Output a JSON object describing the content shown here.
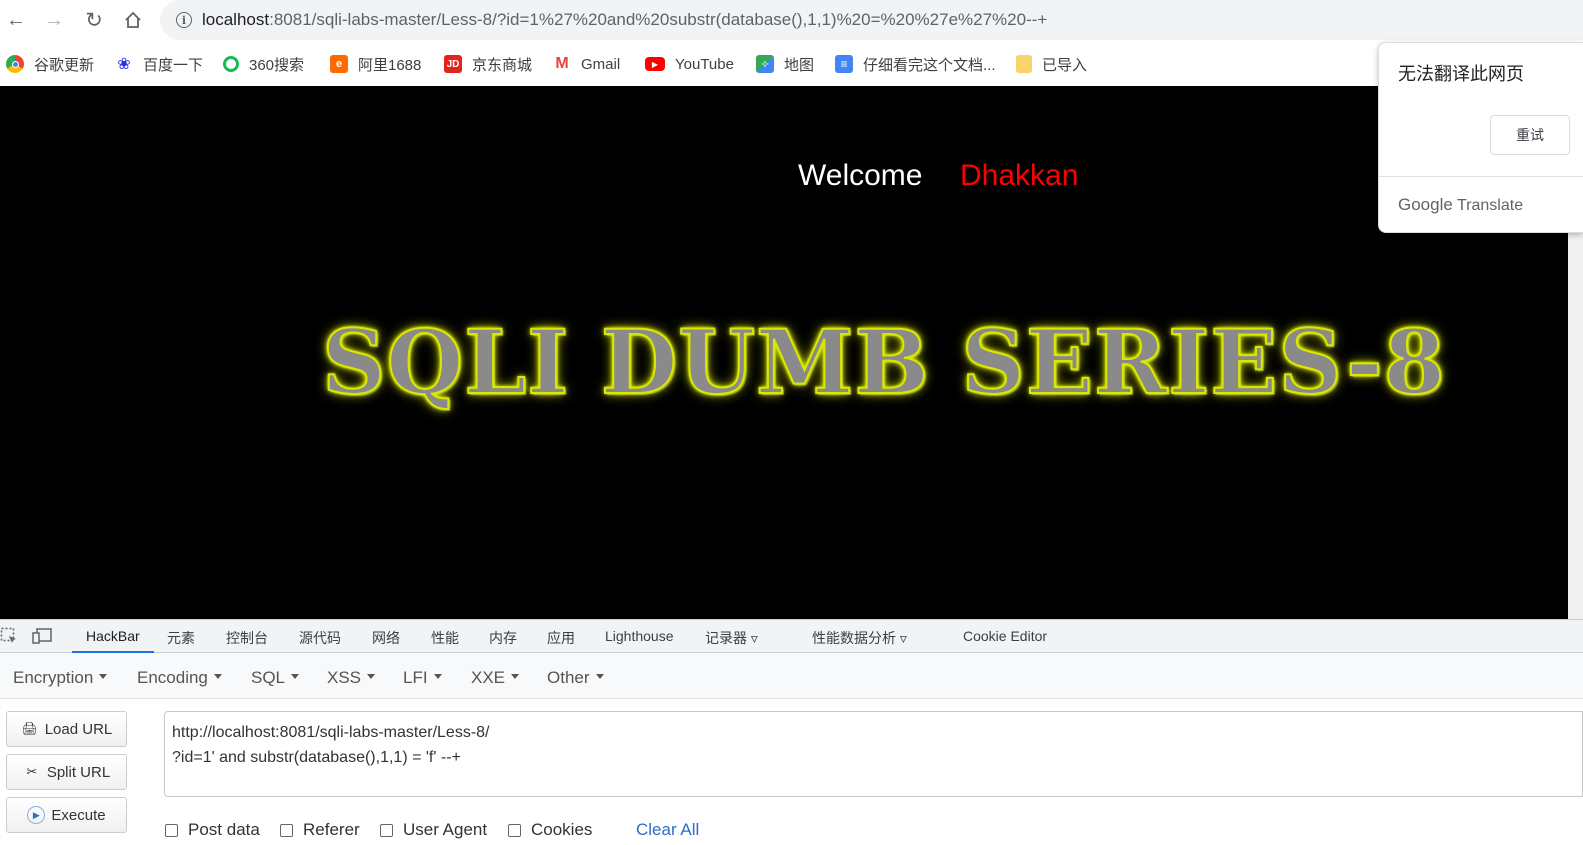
{
  "browser": {
    "address_host": "localhost",
    "address_rest": ":8081/sqli-labs-master/Less-8/?id=1%27%20and%20substr(database(),1,1)%20=%20%27e%27%20--+"
  },
  "bookmarks": [
    {
      "label": "谷歌更新",
      "icon": "chrome-icon",
      "color": "#4285f4"
    },
    {
      "label": "百度一下",
      "icon": "baidu-paw-icon",
      "color": "#2932e1"
    },
    {
      "label": "360搜索",
      "icon": "360-search-icon",
      "color": "#19b955"
    },
    {
      "label": "阿里1688",
      "icon": "alibaba-1688-icon",
      "color": "#ff6a00"
    },
    {
      "label": "京东商城",
      "icon": "jd-icon",
      "color": "#e1251b"
    },
    {
      "label": "Gmail",
      "icon": "gmail-icon",
      "color": "#ea4335"
    },
    {
      "label": "YouTube",
      "icon": "youtube-icon",
      "color": "#ff0000"
    },
    {
      "label": "地图",
      "icon": "maps-icon",
      "color": "#34a853"
    },
    {
      "label": "仔细看完这个文档...",
      "icon": "docs-icon",
      "color": "#4285f4"
    },
    {
      "label": "已导入",
      "icon": "folder-icon",
      "color": "#f9d36b"
    }
  ],
  "page": {
    "welcome": "Welcome",
    "user": "Dhakkan",
    "banner": "SQLI DUMB SERIES-8"
  },
  "translate_popup": {
    "title": "无法翻译此网页",
    "retry": "重试",
    "brand_google": "Google",
    "brand_translate": "Translate"
  },
  "devtools": {
    "tabs": [
      "HackBar",
      "元素",
      "控制台",
      "源代码",
      "网络",
      "性能",
      "内存",
      "应用",
      "Lighthouse",
      "记录器",
      "性能数据分析",
      "Cookie Editor"
    ]
  },
  "hackbar": {
    "menus": [
      "Encryption",
      "Encoding",
      "SQL",
      "XSS",
      "LFI",
      "XXE",
      "Other"
    ],
    "load_url": "Load URL",
    "split_url": "Split URL",
    "execute": "Execute",
    "url_line1": "http://localhost:8081/sqli-labs-master/Less-8/",
    "url_line2": "?id=1' and substr(database(),1,1) = 'f' --+",
    "options": [
      "Post data",
      "Referer",
      "User Agent",
      "Cookies"
    ],
    "clear_all": "Clear All"
  }
}
